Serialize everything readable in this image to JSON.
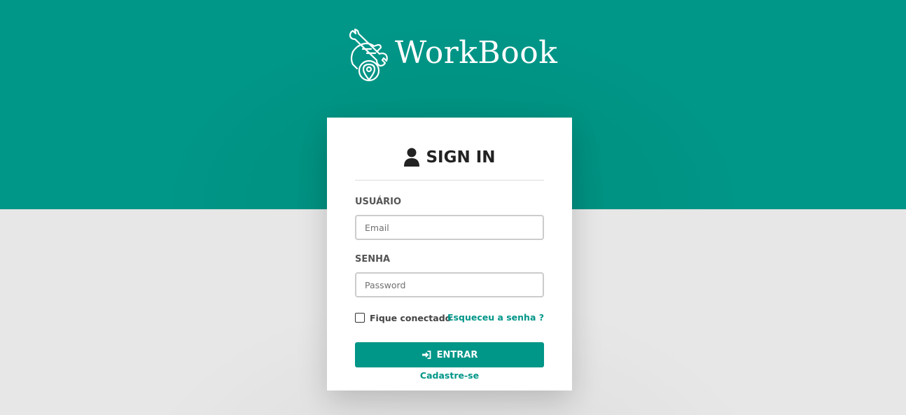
{
  "brand": {
    "name": "WorkBook",
    "icon": "wrench-hand-location-icon"
  },
  "login": {
    "title": "SIGN IN",
    "title_icon": "user-icon",
    "username_label": "USUÁRIO",
    "username_placeholder": "Email",
    "username_value": "",
    "password_label": "SENHA",
    "password_placeholder": "Password",
    "password_value": "",
    "remember_label": "Fique conectado",
    "remember_checked": false,
    "forgot_link": "Esqueceu a senha ?",
    "submit_label": "ENTRAR",
    "submit_icon": "sign-in-icon",
    "register_link": "Cadastre-se"
  },
  "colors": {
    "primary": "#009688",
    "background": "#e5e5e5",
    "card": "#ffffff",
    "title_text": "#222222",
    "label_text": "#555555"
  }
}
